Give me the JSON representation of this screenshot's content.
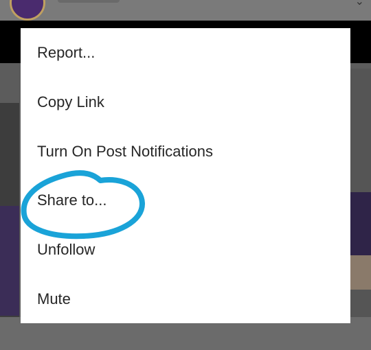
{
  "menu": {
    "items": [
      {
        "label": "Report..."
      },
      {
        "label": "Copy Link"
      },
      {
        "label": "Turn On Post Notifications"
      },
      {
        "label": "Share to..."
      },
      {
        "label": "Unfollow"
      },
      {
        "label": "Mute"
      }
    ]
  },
  "annotation": {
    "highlighted_item": "Share to...",
    "color": "#1aa3d8"
  },
  "colors": {
    "overlay": "#5f5f5f",
    "menu_background": "#ffffff",
    "text": "#262626"
  }
}
